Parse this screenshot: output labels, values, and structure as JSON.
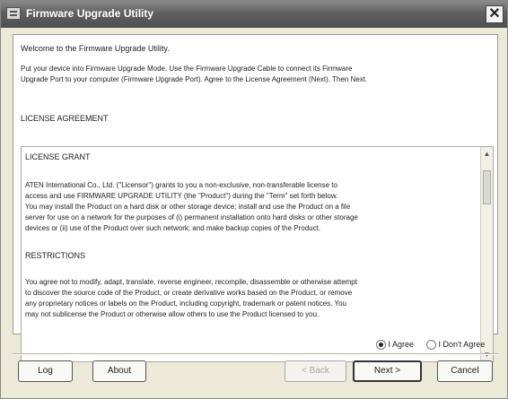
{
  "window": {
    "title": "Firmware Upgrade Utility"
  },
  "intro": {
    "welcome": "Welcome to the Firmware Upgrade Utility.",
    "line1": "Put your device into Firmware Upgrade Mode. Use the Firmware Upgrade Cable to connect its Firmware",
    "line2": "Upgrade Port to your computer (Firmware Upgrade Port). Agree to the License Agreement (Next). Then Next."
  },
  "license": {
    "heading": "LICENSE AGREEMENT",
    "grant_heading": "LICENSE GRANT",
    "grant_lines": [
      "ATEN International Co., Ltd. (\"Licensor\") grants to you a non-exclusive, non-transferable license to",
      "access and use FIRMWARE UPGRADE UTILITY (the \"Product\") during the \"Term\" set forth below.",
      "You may install the Product on a hard disk or other storage device; install and use the Product on a file",
      "server for use on a network for the purposes of (i) permanent installation onto hard disks or other storage",
      "devices or (ii) use of the Product over such network; and make backup copies of the Product."
    ],
    "restrictions_heading": "RESTRICTIONS",
    "restriction_lines": [
      "You agree not to modify, adapt, translate, reverse engineer, recompile, disassemble or otherwise attempt",
      "to discover the source code of the Product, or create derivative works based on the Product, or remove",
      "any proprietary notices or labels on the Product, including copyright, trademark or patent notices. You",
      "may not sublicense the Product or otherwise allow others to use the Product licensed to you."
    ]
  },
  "radios": {
    "agree": "I Agree",
    "disagree": "I Don't Agree",
    "selected": "agree"
  },
  "buttons": {
    "log": "Log",
    "about": "About",
    "back": "< Back",
    "next": "Next >",
    "cancel": "Cancel"
  }
}
